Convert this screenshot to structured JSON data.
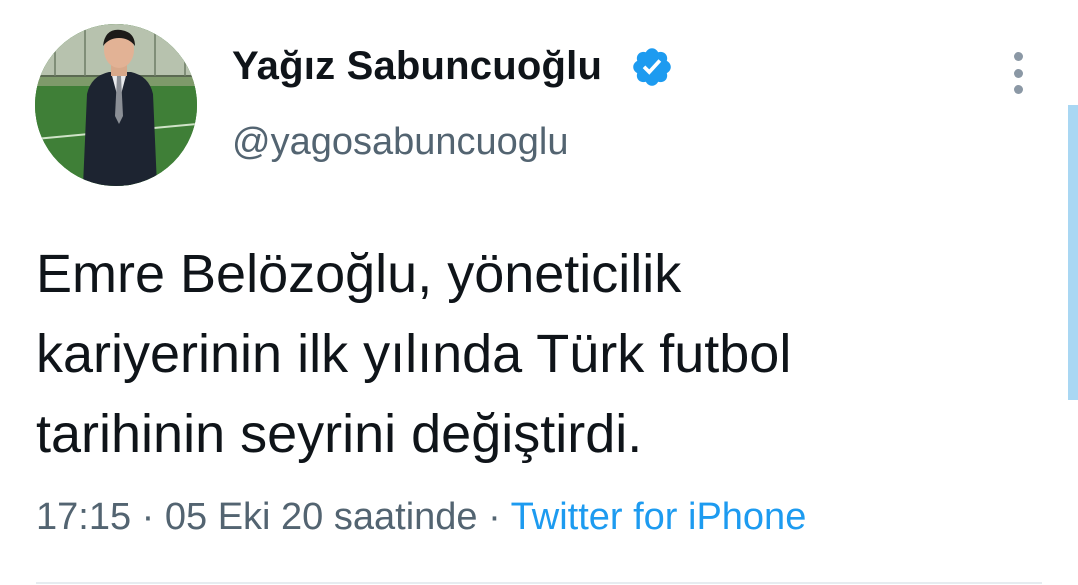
{
  "author": {
    "display_name": "Yağız Sabuncuoğlu",
    "handle": "@yagosabuncuoglu",
    "verified": true,
    "verified_icon": "verified-badge-icon",
    "avatar": "profile-photo"
  },
  "tweet": {
    "text": "Emre Belözoğlu, yöneticilik\nkariyerinin ilk yılında Türk futbol\ntarihinin seyrini değiştirdi.",
    "time": "17:15",
    "separator": "·",
    "date": "05 Eki 20 saatinde",
    "source": "Twitter for iPhone"
  },
  "menu": {
    "icon": "more-vertical-icon"
  },
  "colors": {
    "text": "#0f1419",
    "secondary": "#536471",
    "accent": "#1d9bf0",
    "verified": "#1d9bf0",
    "scrollbar": "#a9d7f3"
  }
}
